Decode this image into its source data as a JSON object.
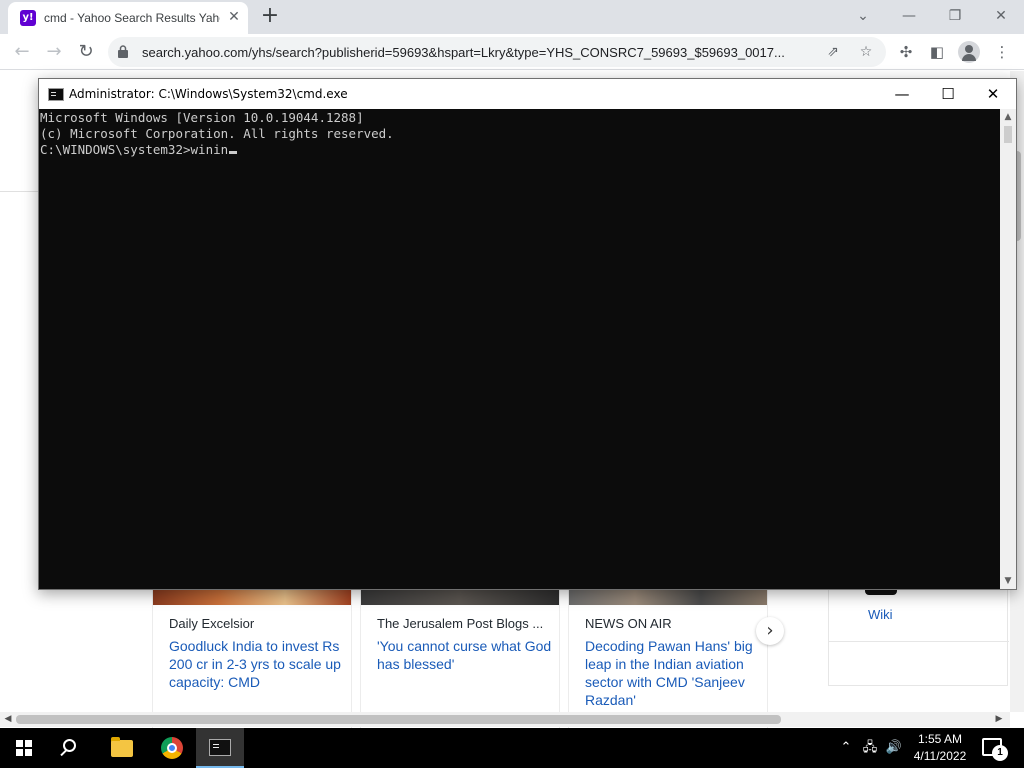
{
  "browser": {
    "tab": {
      "favicon_letter": "y!",
      "title": "cmd - Yahoo Search Results Yahoo",
      "close_glyph": "✕"
    },
    "new_tab_glyph": "+",
    "window_controls": {
      "dropdown": "⌄",
      "minimize": "—",
      "restore": "❐",
      "close": "✕"
    },
    "nav": {
      "back": "←",
      "forward": "→",
      "reload": "↻"
    },
    "url": "search.yahoo.com/yhs/search?publisherid=59693&hspart=Lkry&type=YHS_CONSRC7_59693_$59693_0017...",
    "omnibox_icons": {
      "share": "⇗",
      "bookmark": "☆"
    },
    "toolbar_icons": {
      "extensions": "✣",
      "sidepanel": "◧",
      "menu": "⋮"
    }
  },
  "page": {
    "news": [
      {
        "source": "Daily Excelsior",
        "title": "Goodluck India to invest Rs 200 cr in 2-3 yrs to scale up capacity: CMD"
      },
      {
        "source": "The Jerusalem Post Blogs ...",
        "title": "'You cannot curse what God has blessed'"
      },
      {
        "source": "NEWS ON AIR",
        "title": "Decoding Pawan Hans' big leap in the Indian aviation sector with CMD 'Sanjeev Razdan'"
      }
    ],
    "carousel_next": "›",
    "wiki_label": "Wiki",
    "hscroll_left": "◀",
    "hscroll_right": "▶"
  },
  "cmd": {
    "title": "Administrator: C:\\Windows\\System32\\cmd.exe",
    "controls": {
      "minimize": "—",
      "maximize": "☐",
      "close": "✕"
    },
    "lines": [
      "Microsoft Windows [Version 10.0.19044.1288]",
      "(c) Microsoft Corporation. All rights reserved.",
      "",
      "C:\\WINDOWS\\system32>winin"
    ],
    "scroll_up": "▲",
    "scroll_down": "▼"
  },
  "taskbar": {
    "tray": {
      "chevron": "⌃",
      "network": "🖧",
      "volume": "🔊"
    },
    "time": "1:55 AM",
    "date": "4/11/2022",
    "notification_count": "1"
  },
  "colors": {
    "console_bg": "#0c0c0c",
    "console_text": "#cccccc",
    "link": "#1a5bb8",
    "yahoo_purple": "#6001d2"
  }
}
